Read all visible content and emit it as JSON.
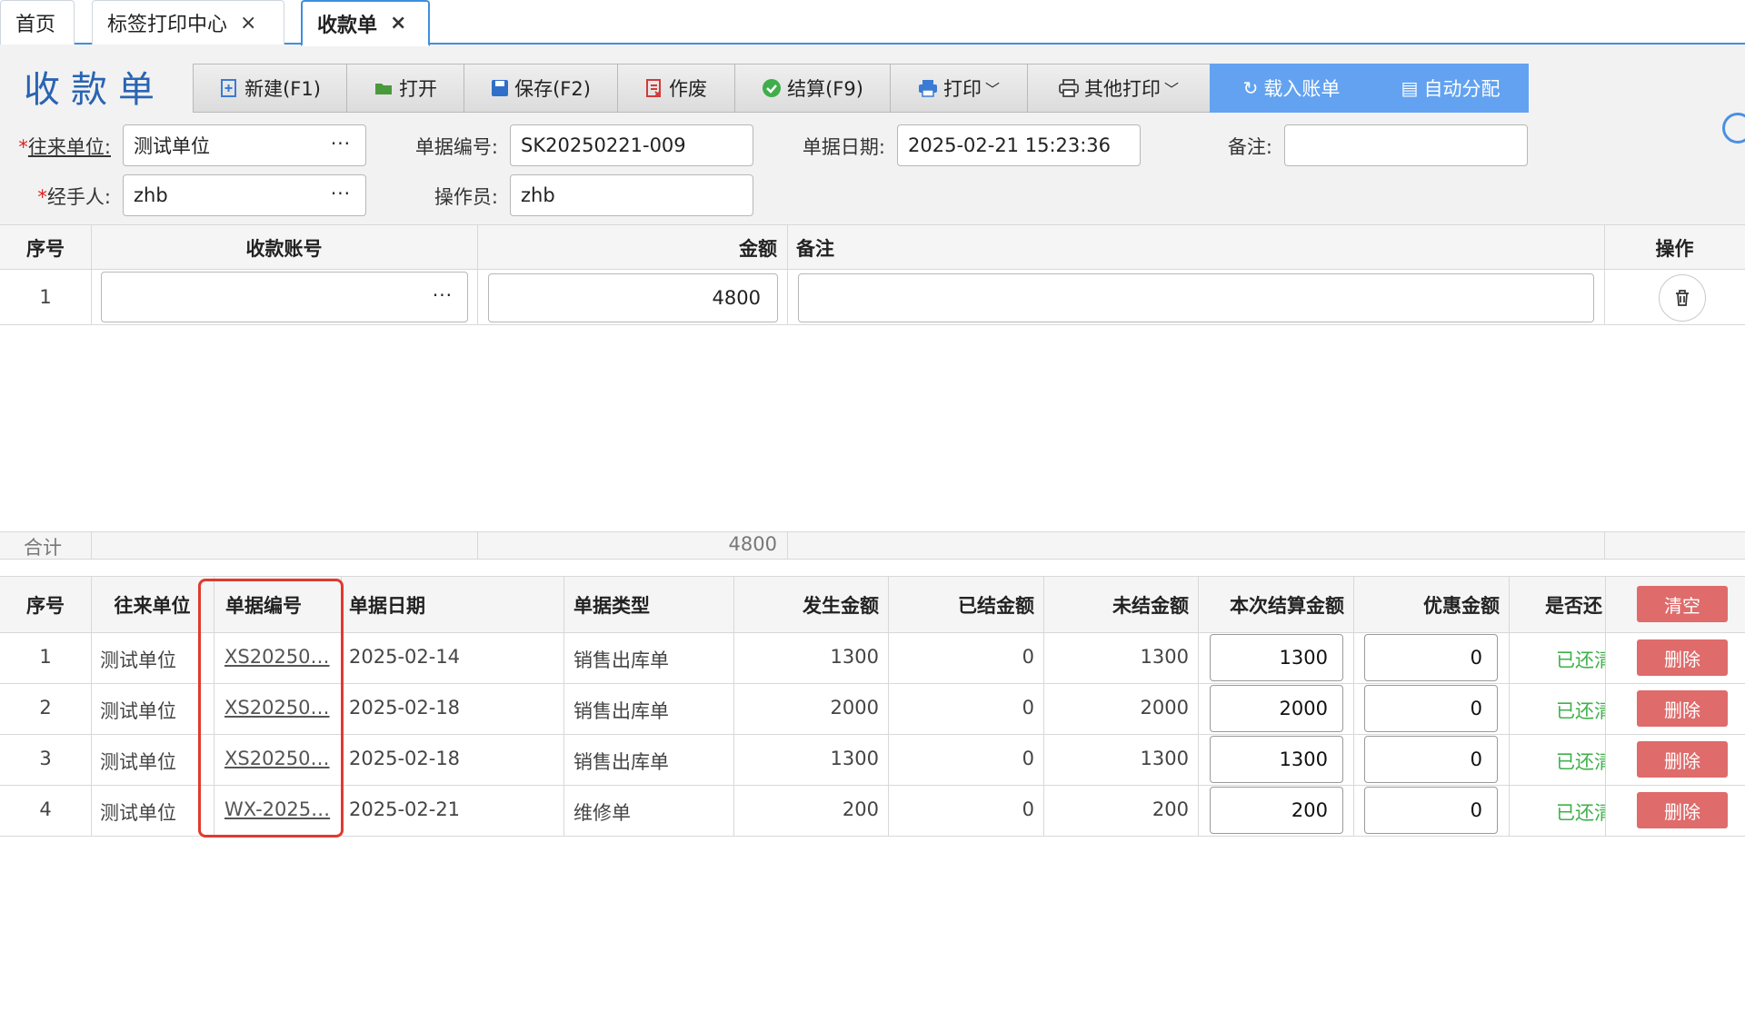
{
  "tabs": [
    {
      "label": "首页"
    },
    {
      "label": "标签打印中心",
      "close": "×"
    },
    {
      "label": "收款单",
      "close": "×"
    }
  ],
  "page_title": "收款单",
  "toolbar": {
    "new": {
      "label": "新建(F1)",
      "icon": "new-doc-icon"
    },
    "open": {
      "label": "打开",
      "icon": "folder-icon"
    },
    "save": {
      "label": "保存(F2)",
      "icon": "save-icon"
    },
    "void": {
      "label": "作废",
      "icon": "void-icon"
    },
    "settle": {
      "label": "结算(F9)",
      "icon": "check-circle-icon"
    },
    "print": {
      "label": "打印",
      "icon": "printer-icon"
    },
    "other_print": {
      "label": "其他打印",
      "icon": "printer-outline-icon"
    },
    "load_bill": {
      "label": "载入账单",
      "icon": "refresh-icon"
    },
    "auto_alloc": {
      "label": "自动分配",
      "icon": "clipboard-icon"
    }
  },
  "form": {
    "partner_label": "往来单位:",
    "partner_value": "测试单位",
    "doc_no_label": "单据编号:",
    "doc_no_value": "SK20250221-009",
    "doc_date_label": "单据日期:",
    "doc_date_value": "2025-02-21 15:23:36",
    "remark_label": "备注:",
    "remark_value": "",
    "handler_label": "经手人:",
    "handler_value": "zhb",
    "operator_label": "操作员:",
    "operator_value": "zhb",
    "required_mark": "*",
    "picker_dots": "···"
  },
  "account_grid": {
    "headers": {
      "seq": "序号",
      "account": "收款账号",
      "amount": "金额",
      "remark": "备注",
      "action": "操作"
    },
    "rows": [
      {
        "seq": "1",
        "account": "",
        "amount": "4800",
        "remark": ""
      }
    ],
    "total_label": "合计",
    "total_amount": "4800"
  },
  "bill_grid": {
    "headers": {
      "seq": "序号",
      "partner": "往来单位",
      "doc_no": "单据编号",
      "date": "单据日期",
      "type": "单据类型",
      "occur": "发生金额",
      "settled": "已结金额",
      "unsettled": "未结金额",
      "this_settle": "本次结算金额",
      "discount": "优惠金额",
      "returned": "是否还",
      "clear": "清空"
    },
    "rows": [
      {
        "seq": "1",
        "partner": "测试单位",
        "doc_no": "XS20250…",
        "date": "2025-02-14",
        "type": "销售出库单",
        "occur": "1300",
        "settled": "0",
        "unsettled": "1300",
        "this_settle": "1300",
        "discount": "0",
        "returned": "已还清",
        "delete": "删除"
      },
      {
        "seq": "2",
        "partner": "测试单位",
        "doc_no": "XS20250…",
        "date": "2025-02-18",
        "type": "销售出库单",
        "occur": "2000",
        "settled": "0",
        "unsettled": "2000",
        "this_settle": "2000",
        "discount": "0",
        "returned": "已还清",
        "delete": "删除"
      },
      {
        "seq": "3",
        "partner": "测试单位",
        "doc_no": "XS20250…",
        "date": "2025-02-18",
        "type": "销售出库单",
        "occur": "1300",
        "settled": "0",
        "unsettled": "1300",
        "this_settle": "1300",
        "discount": "0",
        "returned": "已还清",
        "delete": "删除"
      },
      {
        "seq": "4",
        "partner": "测试单位",
        "doc_no": "WX-2025…",
        "date": "2025-02-21",
        "type": "维修单",
        "occur": "200",
        "settled": "0",
        "unsettled": "200",
        "this_settle": "200",
        "discount": "0",
        "returned": "已还清",
        "delete": "删除"
      }
    ]
  },
  "colors": {
    "accent": "#3d8fe0",
    "title": "#2a64b2",
    "blue_button": "#62a2f0",
    "danger": "#df6b6b",
    "success": "#3fb04b",
    "highlight": "#e03a2f"
  }
}
